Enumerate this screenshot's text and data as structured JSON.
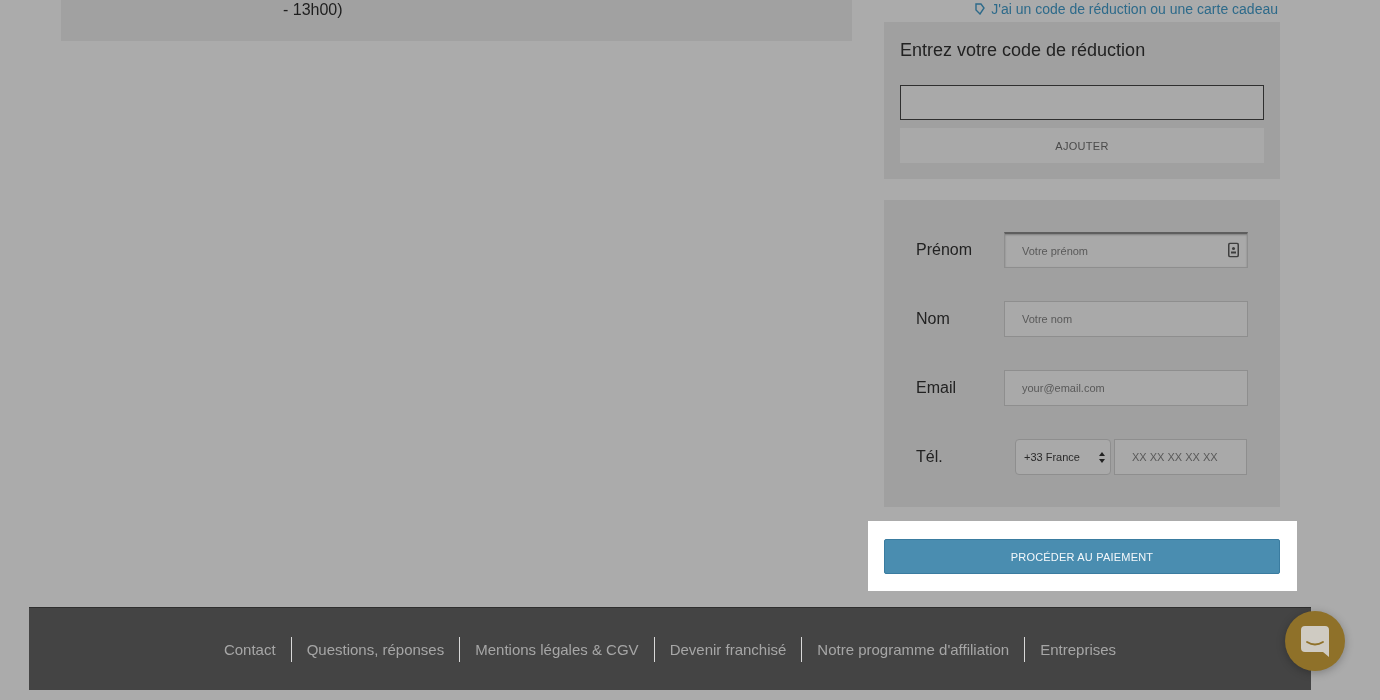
{
  "order_note": {
    "text": "- 13h00)"
  },
  "discount_link": {
    "label": "J'ai un code de réduction ou une carte cadeau"
  },
  "discount_card": {
    "title": "Entrez votre code de réduction",
    "button": "AJOUTER"
  },
  "contact_form": {
    "fields": [
      {
        "kind": "text",
        "label": "Prénom",
        "placeholder": "Votre prénom",
        "focused": true,
        "autofill_icon": true
      },
      {
        "kind": "text",
        "label": "Nom",
        "placeholder": "Votre nom",
        "focused": false,
        "autofill_icon": false
      },
      {
        "kind": "text",
        "label": "Email",
        "placeholder": "your@email.com",
        "focused": false,
        "autofill_icon": false
      },
      {
        "kind": "phone",
        "label": "Tél.",
        "country": "+33 France",
        "placeholder": "XX XX XX XX XX",
        "focused": false,
        "autofill_icon": false
      }
    ]
  },
  "payment": {
    "button": "PROCÉDER AU PAIEMENT",
    "highlighted": true
  },
  "footer": {
    "links": [
      "Contact",
      "Questions, réponses",
      "Mentions légales & CGV",
      "Devenir franchisé",
      "Notre programme d'affiliation",
      "Entreprises"
    ]
  }
}
